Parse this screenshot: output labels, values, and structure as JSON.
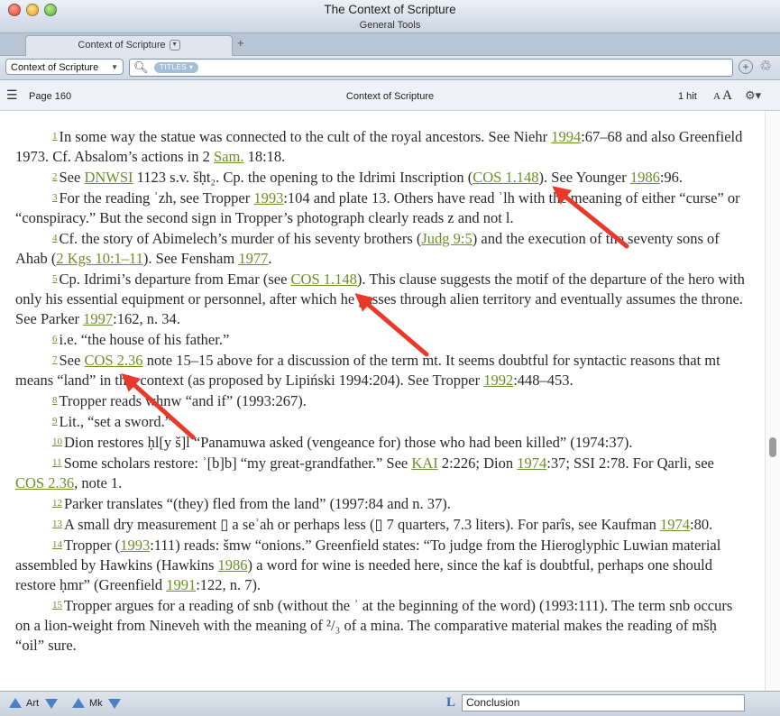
{
  "window": {
    "title": "The Context of Scripture",
    "subtitle": "General Tools"
  },
  "tab": {
    "label": "Context of Scripture",
    "new_tab_glyph": "+"
  },
  "toolbar": {
    "resource_label": "Context of Scripture",
    "search_chip": "TITLES",
    "search_value": ""
  },
  "infobar": {
    "page_label": "Page 160",
    "doc_title": "Context of Scripture",
    "hits": "1 hit",
    "font_small": "A",
    "font_large": "A"
  },
  "footnotes": [
    {
      "num": "1",
      "parts": [
        {
          "t": "In some way the statue was connected to the cult of the royal ancestors. See Niehr "
        },
        {
          "t": "1994",
          "link": true
        },
        {
          "t": ":67–68 and also Greenfield 1973. Cf. Absalom’s actions in 2 "
        },
        {
          "t": "Sam.",
          "link": true
        },
        {
          "t": " 18:18."
        }
      ]
    },
    {
      "num": "2",
      "parts": [
        {
          "t": "See "
        },
        {
          "t": "DNWSI",
          "link": true
        },
        {
          "t": " 1123 s.v. šḥt₂. Cp. the opening to the Idrimi Inscription ("
        },
        {
          "t": "COS 1.148",
          "link": true
        },
        {
          "t": "). See Younger "
        },
        {
          "t": "1986",
          "link": true
        },
        {
          "t": ":96."
        }
      ]
    },
    {
      "num": "3",
      "parts": [
        {
          "t": "For the reading ʾzh, see Tropper "
        },
        {
          "t": "1993",
          "link": true
        },
        {
          "t": ":104 and plate 13. Others have read ʾlh with the meaning of either “curse” or “conspiracy.” But the second sign in Tropper’s photograph clearly reads z and not l."
        }
      ]
    },
    {
      "num": "4",
      "parts": [
        {
          "t": "Cf. the story of Abimelech’s murder of his seventy brothers ("
        },
        {
          "t": "Judg 9:5",
          "link": true
        },
        {
          "t": ") and the execution of the seventy sons of Ahab ("
        },
        {
          "t": "2 Kgs 10:1–11",
          "link": true
        },
        {
          "t": "). See Fensham "
        },
        {
          "t": "1977",
          "link": true
        },
        {
          "t": "."
        }
      ]
    },
    {
      "num": "5",
      "parts": [
        {
          "t": "Cp. Idrimi’s departure from Emar (see "
        },
        {
          "t": "COS 1.148",
          "link": true
        },
        {
          "t": "). This clause suggests the motif of the departure of the hero with only his essential equipment or personnel, after which he passes through alien territory and eventually assumes the throne. See Parker "
        },
        {
          "t": "1997",
          "link": true
        },
        {
          "t": ":162, n. 34."
        }
      ]
    },
    {
      "num": "6",
      "parts": [
        {
          "t": "i.e. “the house of his father.”"
        }
      ]
    },
    {
      "num": "7",
      "parts": [
        {
          "t": "See "
        },
        {
          "t": "COS 2.36",
          "link": true
        },
        {
          "t": " note 15–15 above for a discussion of the term mt. It seems doubtful for syntactic reasons that mt means “land” in this context (as proposed by Lipiński 1994:204). See Tropper "
        },
        {
          "t": "1992",
          "link": true
        },
        {
          "t": ":448–453."
        }
      ]
    },
    {
      "num": "8",
      "parts": [
        {
          "t": "Tropper reads whnw “and if” (1993:267)."
        }
      ]
    },
    {
      "num": "9",
      "parts": [
        {
          "t": "Lit., “set a sword.”"
        }
      ]
    },
    {
      "num": "10",
      "parts": [
        {
          "t": "Dion restores ḥl[y š]l “Panamuwa asked (vengeance for) those who had been killed” (1974:37)."
        }
      ]
    },
    {
      "num": "11",
      "parts": [
        {
          "t": "Some scholars restore: ʾ[b]b] “my great-grandfather.” See "
        },
        {
          "t": "KAI",
          "link": true
        },
        {
          "t": " 2:226; Dion "
        },
        {
          "t": "1974",
          "link": true
        },
        {
          "t": ":37; SSI 2:78. For Qarli, see "
        },
        {
          "t": "COS 2.36",
          "link": true
        },
        {
          "t": ", note 1."
        }
      ]
    },
    {
      "num": "12",
      "parts": [
        {
          "t": "Parker translates “(they) fled from the land” (1997:84 and n. 37)."
        }
      ]
    },
    {
      "num": "13",
      "parts": [
        {
          "t": "A small dry measurement ▯ a seʾah or perhaps less (▯ 7 quarters, 7.3 liters). For parîs, see Kaufman "
        },
        {
          "t": "1974",
          "link": true
        },
        {
          "t": ":80."
        }
      ]
    },
    {
      "num": "14",
      "parts": [
        {
          "t": "Tropper ("
        },
        {
          "t": "1993",
          "link": true
        },
        {
          "t": ":111) reads: šmw “onions.” Greenfield states: “To judge from the Hieroglyphic Luwian material assembled by Hawkins (Hawkins "
        },
        {
          "t": "1986",
          "link": true
        },
        {
          "t": ") a word for wine is needed here, since the kaf is doubtful, perhaps one should restore ḥmr” (Greenfield "
        },
        {
          "t": "1991",
          "link": true
        },
        {
          "t": ":122, n. 7)."
        }
      ]
    },
    {
      "num": "15",
      "parts": [
        {
          "t": "Tropper argues for a reading of snb (without the ʾ at the beginning of the word) (1993:111). The term snb occurs on a lion-weight from Nineveh with the meaning of ²/₃ of a mina. The comparative material makes the reading of mšḥ “oil” sure."
        }
      ]
    }
  ],
  "bottombar": {
    "art_label": "Art",
    "mk_label": "Mk",
    "conclusion_value": "Conclusion"
  },
  "colors": {
    "link": "#6d8f2a",
    "arrow": "#e8392a"
  }
}
